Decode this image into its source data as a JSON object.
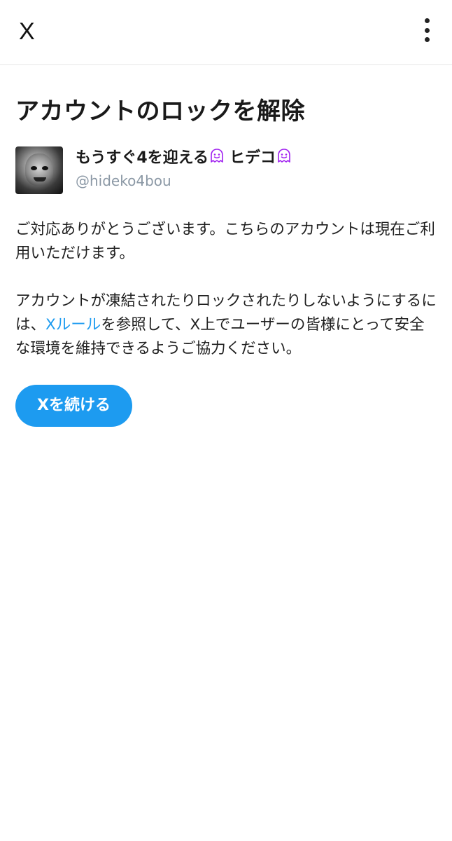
{
  "header": {
    "close_label": "X",
    "menu_icon": "more-vertical-icon"
  },
  "page": {
    "title": "アカウントのロックを解除"
  },
  "profile": {
    "display_name_part1": "もうすぐ4を迎える",
    "display_name_part2": "ヒデコ",
    "handle": "@hideko4bou",
    "emoji_icon": "ghost-icon",
    "emoji_color": "#a020f0"
  },
  "body": {
    "paragraph1": "ご対応ありがとうございます。こちらのアカウントは現在ご利用いただけます。",
    "paragraph2_before": "アカウントが凍結されたりロックされたりしないようにするには、",
    "paragraph2_link": "Xルール",
    "paragraph2_after": "を参照して、X上でユーザーの皆様にとって安全な環境を維持できるようご協力ください。"
  },
  "actions": {
    "continue_label": "Xを続ける"
  },
  "colors": {
    "accent": "#1d9bf0",
    "handle_gray": "#8b98a5"
  }
}
